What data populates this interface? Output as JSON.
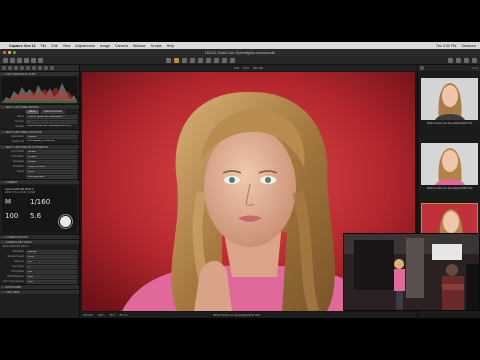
{
  "menubar": {
    "app": "Capture One 12",
    "items": [
      "File",
      "Edit",
      "View",
      "Adjustments",
      "Image",
      "Camera",
      "Window",
      "Scripts",
      "Help"
    ],
    "clock": "Thu 3:30 PM",
    "user": "Sessions"
  },
  "window": {
    "title": "180211 Dofek Live Speedlights.cosessiondb"
  },
  "left_panel": {
    "histogram_title": "CAPTURE/DSLR 12 BIT",
    "next_capture_naming": {
      "title": "NEXT CAPTURE NAMING",
      "format_label": "Format",
      "format_options": [
        "Name",
        "Camera Counter"
      ],
      "name_label": "Name",
      "name_value": "180211 Dofek Live Speedlights",
      "counter_label": "Counter",
      "counter_value": "1",
      "sample_label": "Sample",
      "sample_value": "180211 Dofek Live Speedlights0001.IIQ"
    },
    "next_capture_location": {
      "title": "NEXT CAPTURE LOCATION",
      "destination_label": "Destination",
      "destination_value": "Capture",
      "space_label": "Space left",
      "space_value": "4TB capacity (TB/DLRS)"
    },
    "next_capture_adjustments": {
      "title": "NEXT CAPTURE ADJUSTMENTS",
      "rows": [
        {
          "label": "ICC Profile",
          "value": "Default"
        },
        {
          "label": "Orientation",
          "value": "Default"
        },
        {
          "label": "Metadata",
          "value": "Default"
        },
        {
          "label": "All Others",
          "value": "Copy from Last"
        },
        {
          "label": "Styles",
          "value": "None"
        },
        {
          "label": "",
          "value": "Auto alignment"
        }
      ]
    },
    "camera": {
      "title": "CAMERA",
      "model": "Canon EOS 5D Mark II",
      "lens": "EF24-70mm f/2.8L II USM",
      "mode": "M",
      "shutter": "1/160",
      "iso": "100",
      "aperture": "5.6"
    },
    "camera_focus": {
      "title": "CAMERA FOCUS"
    },
    "camera_settings": {
      "title": "CAMERA SETTINGS"
    },
    "settings_rows": [
      {
        "label": "Canon EOS 5D Mark II",
        "value": ""
      },
      {
        "label": "ISO Mode",
        "value": "Manual"
      },
      {
        "label": "Shutter Speed",
        "value": "1/160"
      },
      {
        "label": "Aperture",
        "value": "5.6"
      },
      {
        "label": "Exp comp",
        "value": "0"
      },
      {
        "label": "ISO Speed",
        "value": "100"
      },
      {
        "label": "White Balance",
        "value": "Auto"
      },
      {
        "label": "Color Temperature",
        "value": "5200"
      }
    ],
    "exposure_title": "EXPOSURE",
    "live_view_title": "LIVE VIEW"
  },
  "viewer": {
    "top_info": [
      "1/60",
      "f/5.6",
      "ISO 100"
    ],
    "bottom_info": [
      "ISO 100",
      "1/60 s",
      "f/5.6",
      "85 mm"
    ],
    "filename": "180211 Dofek Live Speedlights0009.CR2"
  },
  "browser": {
    "header": "1 of 9",
    "thumbs": [
      {
        "label": "180211 Dofek Live Speedlights0009.CR2"
      },
      {
        "label": "180211 Dofek Live Speedlights0008.CR2"
      },
      {
        "label": "180211 Dofek Live Speedlights0007.CR2"
      }
    ]
  },
  "colors": {
    "accent": "#c98a2b",
    "backdrop_red": "#b3262d",
    "panel_bg": "#1e1e1e"
  }
}
